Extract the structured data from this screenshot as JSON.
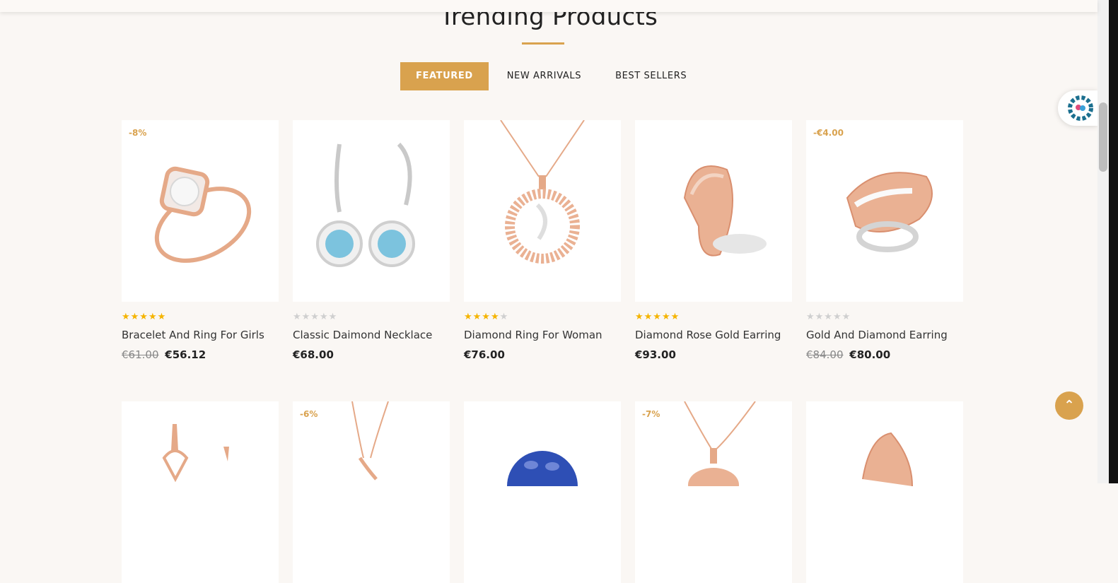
{
  "section": {
    "title": "Trending Products"
  },
  "tabs": [
    {
      "label": "FEATURED",
      "active": true
    },
    {
      "label": "NEW ARRIVALS",
      "active": false
    },
    {
      "label": "BEST SELLERS",
      "active": false
    }
  ],
  "products_row1": [
    {
      "badge": "-8%",
      "rating": 5,
      "name": "Bracelet And Ring For Girls",
      "old_price": "€61.00",
      "price": "€56.12",
      "image": "rose-gold-halo-ring"
    },
    {
      "badge": "",
      "rating": 0,
      "name": "Classic Daimond Necklace",
      "old_price": "",
      "price": "€68.00",
      "image": "blue-stone-drop-earrings"
    },
    {
      "badge": "",
      "rating": 4,
      "name": "Diamond Ring For Woman",
      "old_price": "",
      "price": "€76.00",
      "image": "rose-gold-pendant-necklace"
    },
    {
      "badge": "",
      "rating": 5,
      "name": "Diamond Rose Gold Earring",
      "old_price": "",
      "price": "€93.00",
      "image": "rose-gold-shell-ring"
    },
    {
      "badge": "-€4.00",
      "rating": 0,
      "name": "Gold And Diamond Earring",
      "old_price": "€84.00",
      "price": "€80.00",
      "image": "diamond-cocktail-ring"
    }
  ],
  "products_row2": [
    {
      "badge": "",
      "image": "drop-earrings"
    },
    {
      "badge": "-6%",
      "image": "gold-pendant"
    },
    {
      "badge": "",
      "image": "sapphire-ring"
    },
    {
      "badge": "-7%",
      "image": "heart-pendant"
    },
    {
      "badge": "",
      "image": "rose-gold-band"
    }
  ],
  "colors": {
    "accent": "#d9a24e",
    "star": "#f5b400",
    "background": "#faf7f4"
  },
  "icons": {
    "widget": "accessibility-gear-icon",
    "scroll_top": "double-chevron-up-icon"
  }
}
